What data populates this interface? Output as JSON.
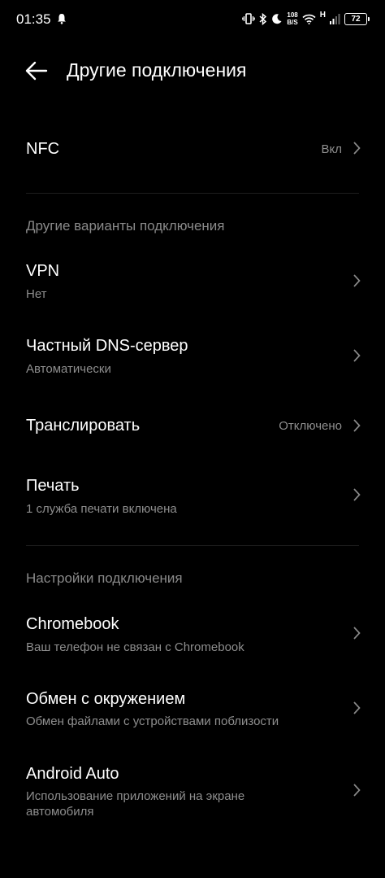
{
  "status": {
    "time": "01:35",
    "speed_top": "108",
    "speed_bottom": "B/S",
    "network": "H",
    "battery": "72"
  },
  "header": {
    "title": "Другие подключения"
  },
  "nfc": {
    "title": "NFC",
    "value": "Вкл"
  },
  "section_other": "Другие варианты подключения",
  "vpn": {
    "title": "VPN",
    "subtitle": "Нет"
  },
  "dns": {
    "title": "Частный DNS-сервер",
    "subtitle": "Автоматически"
  },
  "cast": {
    "title": "Транслировать",
    "value": "Отключено"
  },
  "print": {
    "title": "Печать",
    "subtitle": "1 служба печати включена"
  },
  "section_settings": "Настройки подключения",
  "chromebook": {
    "title": "Chromebook",
    "subtitle": "Ваш телефон не связан с Chromebook"
  },
  "nearby": {
    "title": "Обмен с окружением",
    "subtitle": "Обмен файлами с устройствами поблизости"
  },
  "auto": {
    "title": "Android Auto",
    "subtitle": "Использование приложений на экране автомобиля"
  },
  "icons": [
    "bell-icon",
    "vibrate-icon",
    "bluetooth-icon",
    "moon-icon",
    "wifi-icon",
    "signal-icon",
    "battery-icon",
    "back-arrow-icon",
    "chevron-right-icon"
  ]
}
